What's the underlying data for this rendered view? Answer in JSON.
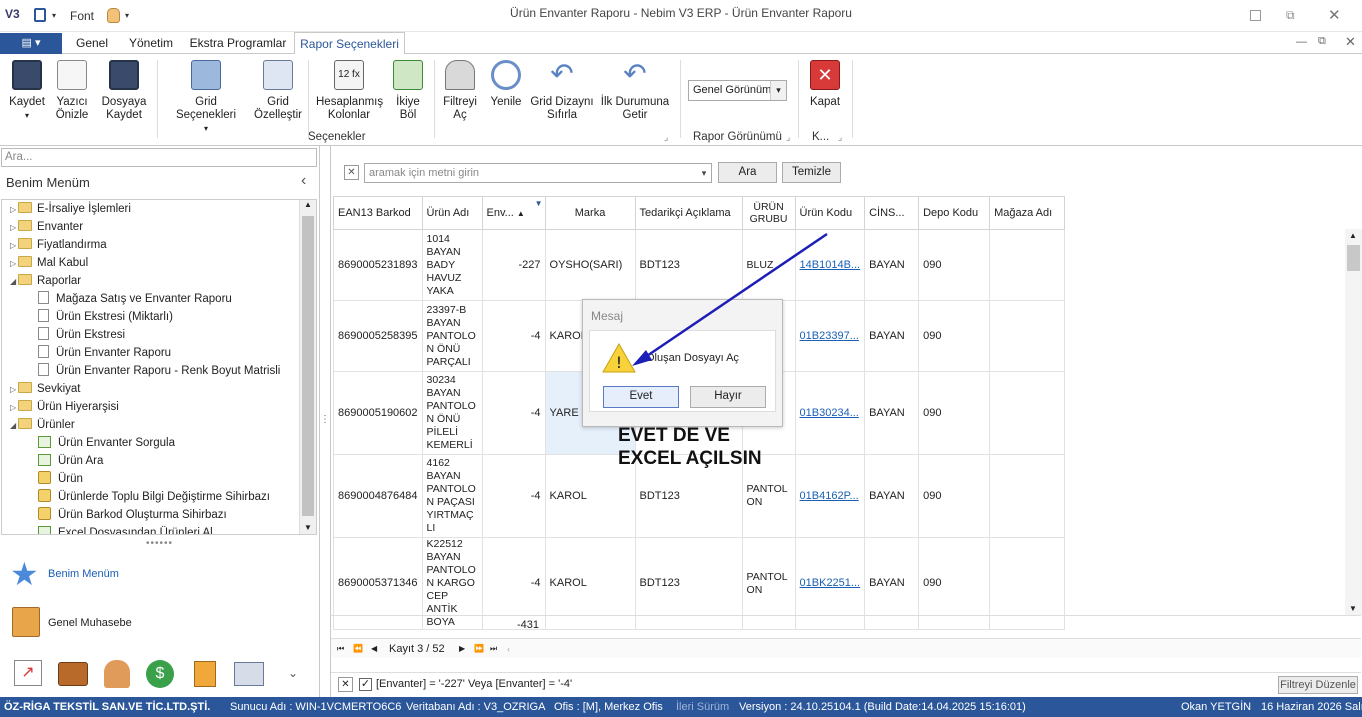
{
  "titlebar": {
    "title": "Ürün Envanter Raporu - Nebim V3 ERP - Ürün Envanter Raporu",
    "font_label": "Font"
  },
  "tabs": [
    {
      "label": "Genel"
    },
    {
      "label": "Yönetim"
    },
    {
      "label": "Ekstra Programlar"
    },
    {
      "label": "Rapor Seçenekleri"
    }
  ],
  "ribbon": {
    "buttons": [
      {
        "label": "Kaydet",
        "icon": "save-icon",
        "dropdown": "▾"
      },
      {
        "label": "Yazıcı Önizle",
        "icon": "print-preview-icon"
      },
      {
        "label": "Dosyaya Kaydet",
        "icon": "save-to-file-icon",
        "dropdown": "▾"
      },
      {
        "label": "Grid Seçenekleri",
        "icon": "grid-options-icon",
        "dropdown": "▾"
      },
      {
        "label": "Grid Özelleştir",
        "icon": "grid-customize-icon"
      },
      {
        "label": "Hesaplanmış Kolonlar",
        "icon": "calculated-columns-icon"
      },
      {
        "label": "İkiye Böl",
        "icon": "split-icon",
        "dropdown": "▾"
      },
      {
        "label": "Filtreyi Aç",
        "icon": "filter-icon"
      },
      {
        "label": "Yenile",
        "icon": "refresh-icon"
      },
      {
        "label": "Grid Dizaynı Sıfırla",
        "icon": "undo-icon"
      },
      {
        "label": "İlk Durumuna Getir",
        "icon": "undo-icon"
      },
      {
        "label": "Kapat",
        "icon": "close-icon"
      }
    ],
    "groups": {
      "secenekler": "Seçenekler",
      "rapor_gorunumu": "Rapor Görünümü",
      "k": "K..."
    },
    "view_select": "Genel Görünüm"
  },
  "left": {
    "search_placeholder": "Ara...",
    "menu_title": "Benim Menüm",
    "tree": [
      {
        "label": "E-İrsaliye İşlemleri",
        "level": 0,
        "type": "folder",
        "expanded": false
      },
      {
        "label": "Envanter",
        "level": 0,
        "type": "folder",
        "expanded": false
      },
      {
        "label": "Fiyatlandırma",
        "level": 0,
        "type": "folder",
        "expanded": false
      },
      {
        "label": "Mal Kabul",
        "level": 0,
        "type": "folder",
        "expanded": false
      },
      {
        "label": "Raporlar",
        "level": 0,
        "type": "folder",
        "expanded": true
      },
      {
        "label": "Mağaza Satış ve Envanter Raporu",
        "level": 1,
        "type": "doc"
      },
      {
        "label": "Ürün Ekstresi (Miktarlı)",
        "level": 1,
        "type": "doc"
      },
      {
        "label": "Ürün Ekstresi",
        "level": 1,
        "type": "doc"
      },
      {
        "label": "Ürün Envanter Raporu",
        "level": 1,
        "type": "doc"
      },
      {
        "label": "Ürün Envanter Raporu - Renk Boyut Matrisli",
        "level": 1,
        "type": "doc"
      },
      {
        "label": "Sevkiyat",
        "level": 0,
        "type": "folder",
        "expanded": false
      },
      {
        "label": "Ürün Hiyerarşisi",
        "level": 0,
        "type": "folder",
        "expanded": false
      },
      {
        "label": "Ürünler",
        "level": 0,
        "type": "folder",
        "expanded": true
      },
      {
        "label": "Ürün Envanter Sorgula",
        "level": 1,
        "type": "grid"
      },
      {
        "label": "Ürün Ara",
        "level": 1,
        "type": "grid"
      },
      {
        "label": "Ürün",
        "level": 1,
        "type": "wand"
      },
      {
        "label": "Ürünlerde Toplu Bilgi Değiştirme Sihirbazı",
        "level": 1,
        "type": "wand"
      },
      {
        "label": "Ürün Barkod Oluşturma Sihirbazı",
        "level": 1,
        "type": "wand"
      },
      {
        "label": "Excel Dosyasından Ürünleri Al",
        "level": 1,
        "type": "grid"
      }
    ],
    "nav_benim": "Benim Menüm",
    "nav_genel": "Genel Muhasebe"
  },
  "search": {
    "placeholder": "aramak için metni girin",
    "ara": "Ara",
    "temizle": "Temizle"
  },
  "grid": {
    "columns": [
      "EAN13 Barkod",
      "Ürün Adı",
      "Env...",
      "Marka",
      "Tedarikçi Açıklama",
      "ÜRÜN GRUBU",
      "Ürün Kodu",
      "CİNS...",
      "Depo Kodu",
      "Mağaza Adı"
    ],
    "rows": [
      {
        "barkod": "8690005231893",
        "urun_adi": "1014 BAYAN BADY HAVUZ YAKA",
        "env": "-227",
        "marka": "OYSHO(SARI)",
        "tedarikci": "BDT123",
        "grup": "BLUZ",
        "kod": "14B1014B...",
        "cins": "BAYAN",
        "depo": "090",
        "magaza": ""
      },
      {
        "barkod": "8690005258395",
        "urun_adi": "23397-B BAYAN PANTOLO N ÖNÜ PARÇALI",
        "env": "-4",
        "marka": "KAROL",
        "tedarikci": "",
        "grup": "",
        "kod": "01B23397...",
        "cins": "BAYAN",
        "depo": "090",
        "magaza": ""
      },
      {
        "barkod": "8690005190602",
        "urun_adi": "30234 BAYAN PANTOLO N ÖNÜ PİLELİ KEMERLİ",
        "env": "-4",
        "marka": "YARE",
        "tedarikci": "",
        "grup": "",
        "kod": "01B30234...",
        "cins": "BAYAN",
        "depo": "090",
        "magaza": ""
      },
      {
        "barkod": "8690004876484",
        "urun_adi": "4162 BAYAN PANTOLO N PAÇASI YIRTMAÇLI",
        "env": "-4",
        "marka": "KAROL",
        "tedarikci": "BDT123",
        "grup": "PANTOL ON",
        "kod": "01B4162P...",
        "cins": "BAYAN",
        "depo": "090",
        "magaza": ""
      },
      {
        "barkod": "8690005371346",
        "urun_adi": "K22512 BAYAN PANTOLO N KARGO CEP ANTİK BOYA",
        "env": "-4",
        "marka": "KAROL",
        "tedarikci": "BDT123",
        "grup": "PANTOL ON",
        "kod": "01BK2251...",
        "cins": "BAYAN",
        "depo": "090",
        "magaza": ""
      }
    ],
    "total": "-431",
    "record_nav": "Kayıt 3 / 52",
    "filter_text": "[Envanter] = '-227' Veya [Envanter] = '-4'",
    "filter_edit": "Filtreyi Düzenle"
  },
  "dialog": {
    "title": "Mesaj",
    "message": "Oluşan Dosyayı Aç",
    "yes": "Evet",
    "no": "Hayır"
  },
  "annotation": {
    "line1": "EVET DE VE",
    "line2": "EXCEL AÇILSIN",
    "color": "#1d1db8"
  },
  "statusbar": {
    "company": "ÖZ-RİGA TEKSTİL SAN.VE TİC.LTD.ŞTİ.",
    "server": "Sunucu Adı : WIN-1VCMERTO6C6",
    "db": "Veritabanı Adı : V3_OZRIGA",
    "office": "Ofis : [M], Merkez Ofis",
    "ileri": "İleri Sürüm",
    "version": "Versiyon : 24.10.25104.1 (Build Date:14.04.2025 15:16:01)",
    "user": "Okan YETGİN",
    "date": "16 Haziran 2026 Salı"
  }
}
